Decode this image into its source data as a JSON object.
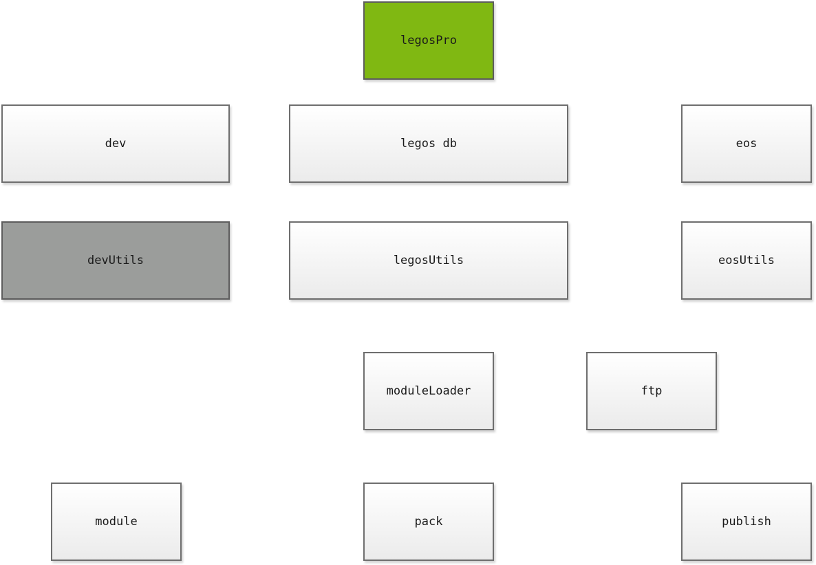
{
  "diagram": {
    "nodes": {
      "legospro": {
        "label": "legosPro",
        "fill": "#80b812"
      },
      "dev": {
        "label": "dev"
      },
      "legosdb": {
        "label": "legos db"
      },
      "eos": {
        "label": "eos"
      },
      "devutils": {
        "label": "devUtils",
        "fill": "#9b9d9b"
      },
      "legosutils": {
        "label": "legosUtils"
      },
      "eosutils": {
        "label": "eosUtils"
      },
      "moduleloader": {
        "label": "moduleLoader"
      },
      "ftp": {
        "label": "ftp"
      },
      "module": {
        "label": "module"
      },
      "pack": {
        "label": "pack"
      },
      "publish": {
        "label": "publish"
      }
    }
  }
}
